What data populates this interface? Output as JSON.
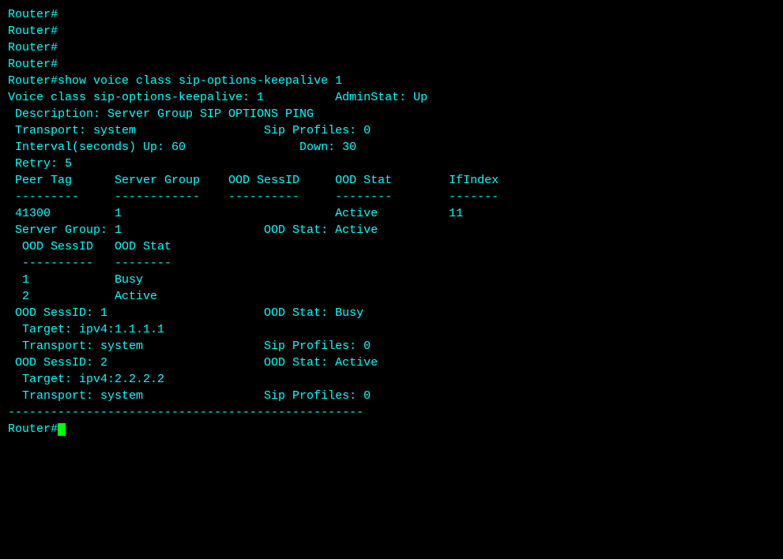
{
  "terminal": {
    "lines": [
      {
        "id": "line1",
        "text": "Router#"
      },
      {
        "id": "line2",
        "text": "Router#"
      },
      {
        "id": "line3",
        "text": "Router#"
      },
      {
        "id": "line4",
        "text": "Router#"
      },
      {
        "id": "line5",
        "text": "Router#show voice class sip-options-keepalive 1"
      },
      {
        "id": "line6",
        "text": "Voice class sip-options-keepalive: 1          AdminStat: Up"
      },
      {
        "id": "line7",
        "text": " Description: Server Group SIP OPTIONS PING"
      },
      {
        "id": "line8",
        "text": " Transport: system                  Sip Profiles: 0"
      },
      {
        "id": "line9",
        "text": " Interval(seconds) Up: 60                Down: 30"
      },
      {
        "id": "line10",
        "text": " Retry: 5"
      },
      {
        "id": "line11",
        "text": ""
      },
      {
        "id": "line12",
        "text": " Peer Tag      Server Group    OOD SessID     OOD Stat        IfIndex"
      },
      {
        "id": "line13",
        "text": " ---------     ------------    ----------     --------        -------"
      },
      {
        "id": "line14",
        "text": ""
      },
      {
        "id": "line15",
        "text": " 41300         1                              Active          11"
      },
      {
        "id": "line16",
        "text": ""
      },
      {
        "id": "line17",
        "text": " Server Group: 1                    OOD Stat: Active"
      },
      {
        "id": "line18",
        "text": "  OOD SessID   OOD Stat"
      },
      {
        "id": "line19",
        "text": "  ----------   --------"
      },
      {
        "id": "line20",
        "text": "  1            Busy"
      },
      {
        "id": "line21",
        "text": "  2            Active"
      },
      {
        "id": "line22",
        "text": ""
      },
      {
        "id": "line23",
        "text": " OOD SessID: 1                      OOD Stat: Busy"
      },
      {
        "id": "line24",
        "text": "  Target: ipv4:1.1.1.1"
      },
      {
        "id": "line25",
        "text": "  Transport: system                 Sip Profiles: 0"
      },
      {
        "id": "line26",
        "text": ""
      },
      {
        "id": "line27",
        "text": " OOD SessID: 2                      OOD Stat: Active"
      },
      {
        "id": "line28",
        "text": "  Target: ipv4:2.2.2.2"
      },
      {
        "id": "line29",
        "text": "  Transport: system                 Sip Profiles: 0"
      },
      {
        "id": "line30",
        "text": ""
      },
      {
        "id": "line31",
        "text": "--------------------------------------------------"
      },
      {
        "id": "line32",
        "text": ""
      },
      {
        "id": "line33",
        "text": "Router#",
        "has_cursor": true
      }
    ],
    "cursor_label": "cursor"
  }
}
